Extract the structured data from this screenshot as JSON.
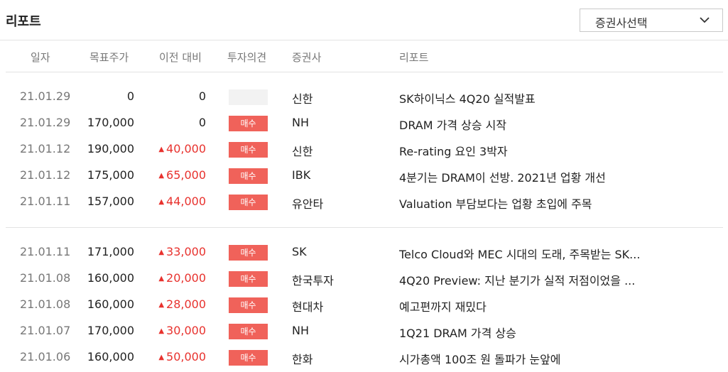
{
  "header": {
    "title": "리포트",
    "broker_select": "증권사선택"
  },
  "columns": [
    "일자",
    "목표주가",
    "이전 대비",
    "투자의견",
    "증권사",
    "리포트"
  ],
  "groups": [
    [
      {
        "date": "21.01.29",
        "target": "0",
        "diff": "0",
        "diff_up": false,
        "opinion": "",
        "broker": "신한",
        "report": "SK하이닉스 4Q20 실적발표"
      },
      {
        "date": "21.01.29",
        "target": "170,000",
        "diff": "0",
        "diff_up": false,
        "opinion": "매수",
        "broker": "NH",
        "report": "DRAM 가격 상승 시작"
      },
      {
        "date": "21.01.12",
        "target": "190,000",
        "diff": "40,000",
        "diff_up": true,
        "opinion": "매수",
        "broker": "신한",
        "report": "Re-rating 요인 3박자"
      },
      {
        "date": "21.01.12",
        "target": "175,000",
        "diff": "65,000",
        "diff_up": true,
        "opinion": "매수",
        "broker": "IBK",
        "report": "4분기는 DRAM이 선방. 2021년 업황 개선"
      },
      {
        "date": "21.01.11",
        "target": "157,000",
        "diff": "44,000",
        "diff_up": true,
        "opinion": "매수",
        "broker": "유안타",
        "report": "Valuation 부담보다는 업황 초입에 주목"
      }
    ],
    [
      {
        "date": "21.01.11",
        "target": "171,000",
        "diff": "33,000",
        "diff_up": true,
        "opinion": "매수",
        "broker": "SK",
        "report": "Telco Cloud와 MEC 시대의 도래, 주목받는 SK..."
      },
      {
        "date": "21.01.08",
        "target": "160,000",
        "diff": "20,000",
        "diff_up": true,
        "opinion": "매수",
        "broker": "한국투자",
        "report": "4Q20 Preview: 지난 분기가 실적 저점이었을 ..."
      },
      {
        "date": "21.01.08",
        "target": "160,000",
        "diff": "28,000",
        "diff_up": true,
        "opinion": "매수",
        "broker": "현대차",
        "report": "예고편까지 재밌다"
      },
      {
        "date": "21.01.07",
        "target": "170,000",
        "diff": "30,000",
        "diff_up": true,
        "opinion": "매수",
        "broker": "NH",
        "report": "1Q21 DRAM 가격 상승"
      },
      {
        "date": "21.01.06",
        "target": "160,000",
        "diff": "50,000",
        "diff_up": true,
        "opinion": "매수",
        "broker": "한화",
        "report": "시가총액 100조 원 돌파가 눈앞에"
      }
    ]
  ]
}
